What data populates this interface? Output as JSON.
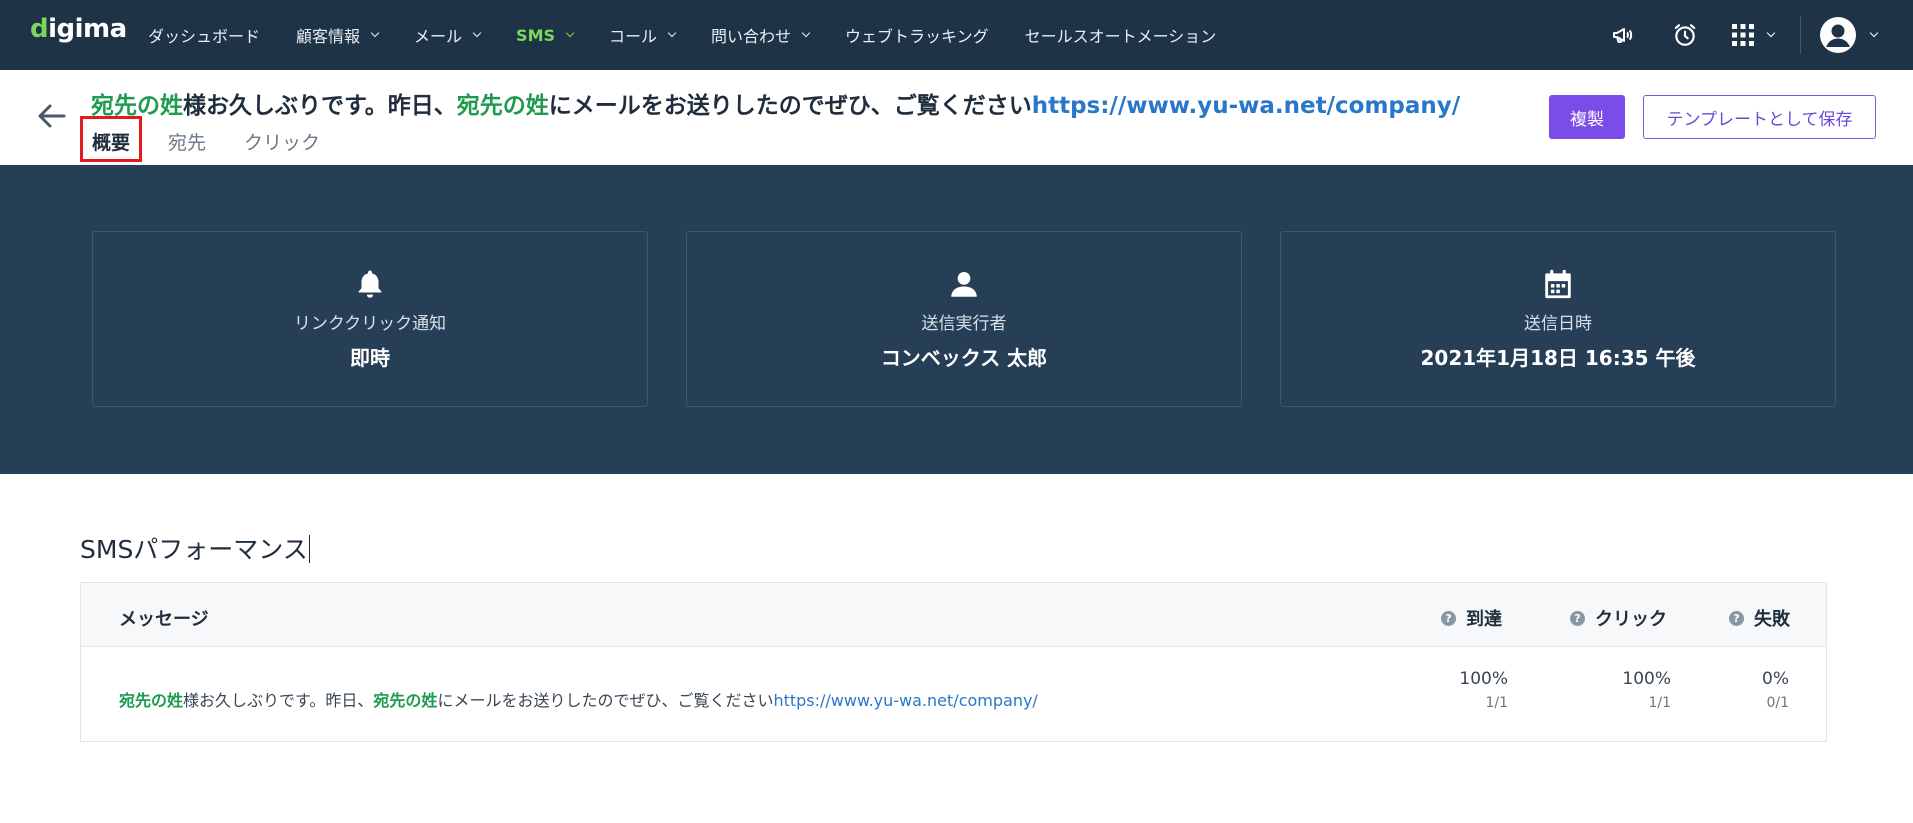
{
  "app": {
    "logo": "digima",
    "nav": [
      {
        "label": "ダッシュボード",
        "caret": false
      },
      {
        "label": "顧客情報",
        "caret": true
      },
      {
        "label": "メール",
        "caret": true
      },
      {
        "label": "SMS",
        "caret": true,
        "active": true
      },
      {
        "label": "コール",
        "caret": true
      },
      {
        "label": "問い合わせ",
        "caret": true
      },
      {
        "label": "ウェブトラッキング",
        "caret": false
      },
      {
        "label": "セールスオートメーション",
        "caret": false
      }
    ],
    "nav_right_icons": [
      "megaphone-icon",
      "alarm-clock-icon",
      "apps-grid-icon",
      "user-avatar-icon"
    ]
  },
  "header": {
    "title_parts": {
      "p1": "宛先の姓",
      "p2": "様お久しぶりです。昨日、",
      "p3": "宛先の姓",
      "p4": "にメールをお送りしたのでぜひ、ご覧ください",
      "p5": "https://www.yu-wa.net/company/"
    },
    "tabs": [
      "概要",
      "宛先",
      "クリック"
    ],
    "active_tab": "概要",
    "duplicate_label": "複製",
    "save_template_label": "テンプレートとして保存"
  },
  "stats": [
    {
      "icon": "bell-icon",
      "label": "リンククリック通知",
      "value": "即時"
    },
    {
      "icon": "person-icon",
      "label": "送信実行者",
      "value": "コンベックス 太郎"
    },
    {
      "icon": "calendar-icon",
      "label": "送信日時",
      "value": "2021年1月18日 16:35 午後"
    }
  ],
  "performance": {
    "title": "SMSパフォーマンス",
    "columns": {
      "message": "メッセージ",
      "delivered": "到達",
      "click": "クリック",
      "failed": "失敗"
    },
    "help_glyph": "?",
    "row": {
      "message_parts": {
        "p1": "宛先の姓",
        "p2": "様お久しぶりです。昨日、",
        "p3": "宛先の姓",
        "p4": "にメールをお送りしたのでぜひ、ご覧ください",
        "p5": "https://www.yu-wa.net/company/"
      },
      "delivered_pct": "100%",
      "delivered_ratio": "1/1",
      "click_pct": "100%",
      "click_ratio": "1/1",
      "failed_pct": "0%",
      "failed_ratio": "0/1"
    }
  },
  "colors": {
    "nav_bg": "#1f3347",
    "band_bg": "#273f56",
    "accent_green": "#1e9b4f",
    "link_blue": "#2877c8",
    "primary_purple": "#7a4de8",
    "tab_highlight": "#e21c1c"
  }
}
